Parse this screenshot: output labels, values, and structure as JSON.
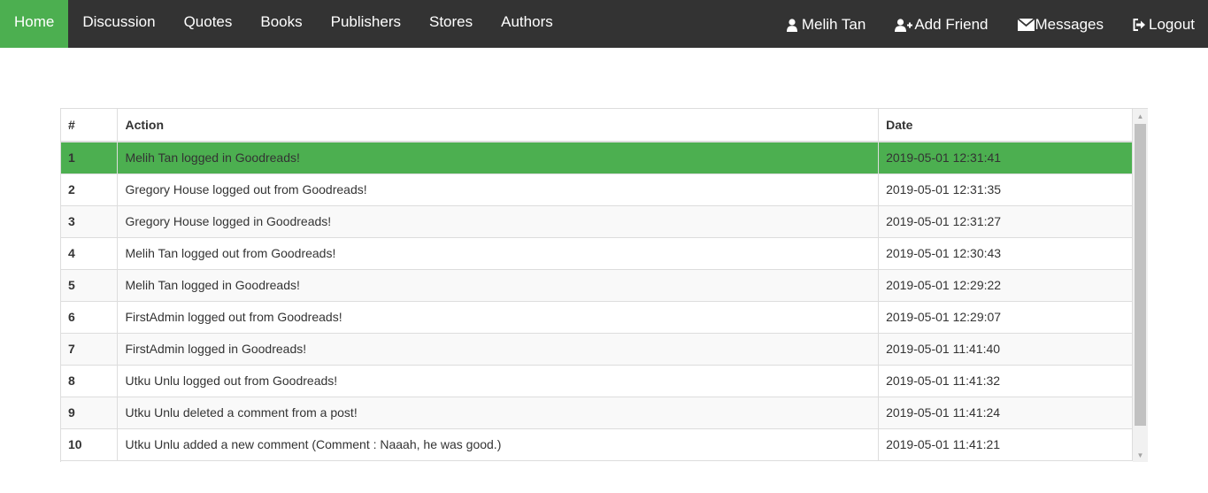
{
  "nav": {
    "home": "Home",
    "discussion": "Discussion",
    "quotes": "Quotes",
    "books": "Books",
    "publishers": "Publishers",
    "stores": "Stores",
    "authors": "Authors",
    "user_name": "Melih Tan",
    "add_friend": "Add Friend",
    "messages": "Messages",
    "logout": "Logout",
    "active_color": "#4caf50",
    "bar_color": "#333333"
  },
  "table": {
    "headers": [
      "#",
      "Action",
      "Date"
    ],
    "rows": [
      {
        "num": "1",
        "action": "Melih Tan logged in Goodreads!",
        "date": "2019-05-01 12:31:41"
      },
      {
        "num": "2",
        "action": "Gregory House logged out from Goodreads!",
        "date": "2019-05-01 12:31:35"
      },
      {
        "num": "3",
        "action": "Gregory House logged in Goodreads!",
        "date": "2019-05-01 12:31:27"
      },
      {
        "num": "4",
        "action": "Melih Tan logged out from Goodreads!",
        "date": "2019-05-01 12:30:43"
      },
      {
        "num": "5",
        "action": "Melih Tan logged in Goodreads!",
        "date": "2019-05-01 12:29:22"
      },
      {
        "num": "6",
        "action": "FirstAdmin logged out from Goodreads!",
        "date": "2019-05-01 12:29:07"
      },
      {
        "num": "7",
        "action": "FirstAdmin logged in Goodreads!",
        "date": "2019-05-01 11:41:40"
      },
      {
        "num": "8",
        "action": "Utku Unlu logged out from Goodreads!",
        "date": "2019-05-01 11:41:32"
      },
      {
        "num": "9",
        "action": "Utku Unlu deleted a comment from a post!",
        "date": "2019-05-01 11:41:24"
      },
      {
        "num": "10",
        "action": "Utku Unlu added a new comment (Comment : Naaah, he was good.)",
        "date": "2019-05-01 11:41:21"
      }
    ],
    "selected_color": "#4caf50"
  }
}
